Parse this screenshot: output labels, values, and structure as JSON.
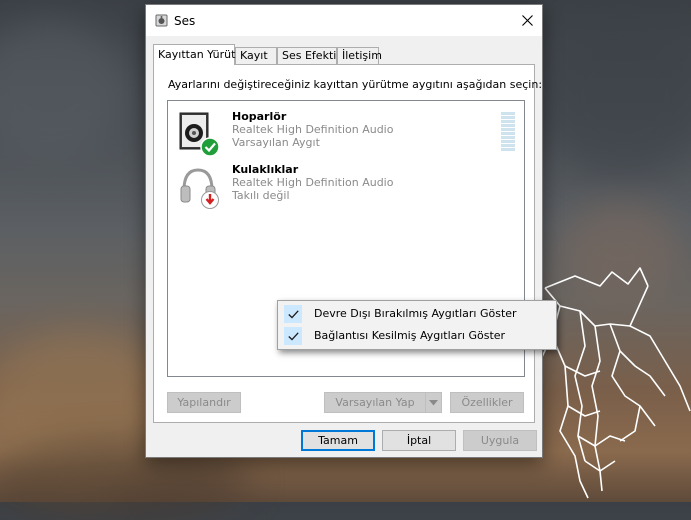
{
  "window": {
    "title": "Ses",
    "tabs": [
      "Kayıttan Yürüt",
      "Kayıt",
      "Ses Efekti",
      "İletişim"
    ],
    "instruction": "Ayarlarını değiştireceğiniz kayıttan yürütme aygıtını aşağıdan seçin:"
  },
  "devices": [
    {
      "name": "Hoparlör",
      "driver": "Realtek High Definition Audio",
      "status": "Varsayılan Aygıt",
      "icon": "speaker-default-icon"
    },
    {
      "name": "Kulaklıklar",
      "driver": "Realtek High Definition Audio",
      "status": "Takılı değil",
      "icon": "headphones-unplugged-icon"
    }
  ],
  "panel_buttons": {
    "configure": "Yapılandır",
    "set_default": "Varsayılan Yap",
    "properties": "Özellikler"
  },
  "dialog_buttons": {
    "ok": "Tamam",
    "cancel": "İptal",
    "apply": "Uygula"
  },
  "context_menu": [
    {
      "label": "Devre Dışı Bırakılmış Aygıtları Göster",
      "checked": true
    },
    {
      "label": "Bağlantısı Kesilmiş Aygıtları Göster",
      "checked": true
    }
  ],
  "colors": {
    "accent": "#0078d7",
    "check_green": "#1f9e3a",
    "unplugged_red": "#d32020"
  }
}
